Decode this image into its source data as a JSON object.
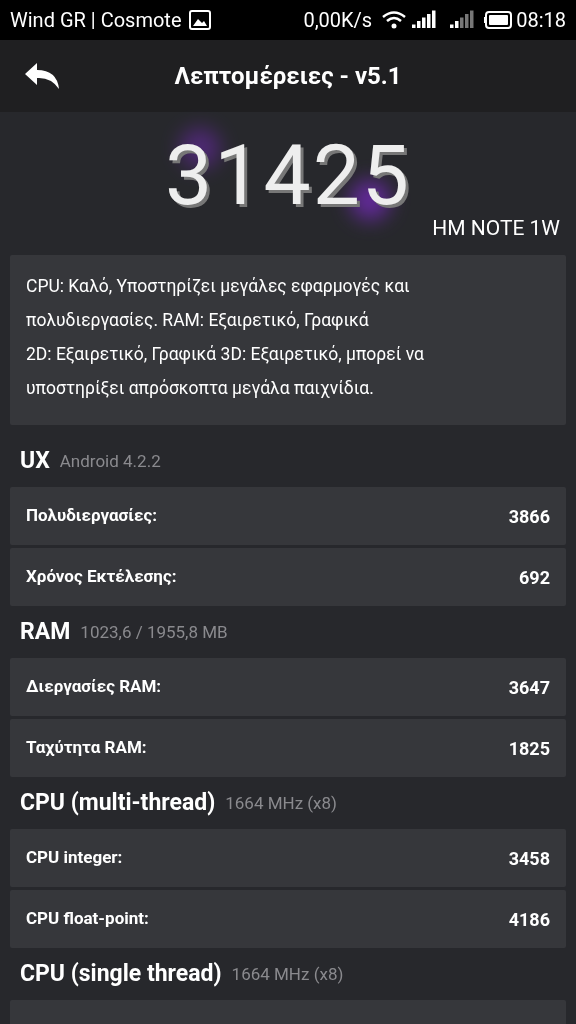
{
  "status_bar": {
    "carrier": "Wind GR | Cosmote",
    "speed": "0,00K/s",
    "time": "08:18"
  },
  "header": {
    "title": "Λεπτομέρειες - v5.1"
  },
  "score": {
    "value": "31425",
    "device": "HM NOTE 1W"
  },
  "description": [
    "CPU: Καλό, Υποστηρίζει μεγάλες εφαρμογές και",
    "πολυδιεργασίες. RAM: Εξαιρετικό, Γραφικά",
    "2D: Εξαιρετικό, Γραφικά 3D: Εξαιρετικό, μπορεί να",
    "υποστηρίξει απρόσκοπτα μεγάλα παιχνίδια."
  ],
  "sections": [
    {
      "title": "UX",
      "subtitle": "Android 4.2.2",
      "rows": [
        {
          "kind": "result",
          "label": "Πολυδιεργασίες:",
          "value": "3866"
        },
        {
          "kind": "result",
          "label": "Χρόνος Εκτέλεσης:",
          "value": "692"
        }
      ]
    },
    {
      "title": "RAM",
      "subtitle": "1023,6 / 1955,8 MB",
      "rows": [
        {
          "kind": "result",
          "label": "Διεργασίες RAM:",
          "value": "3647"
        },
        {
          "kind": "result",
          "label": "Ταχύτητα RAM:",
          "value": "1825"
        }
      ]
    },
    {
      "title": "CPU (multi-thread)",
      "subtitle": "1664 MHz (x8)",
      "rows": [
        {
          "kind": "result",
          "label": "CPU integer:",
          "value": "3458"
        },
        {
          "kind": "result",
          "label": "CPU float-point:",
          "value": "4186"
        }
      ]
    },
    {
      "title": "CPU (single thread)",
      "subtitle": "1664 MHz (x8)",
      "rows": [
        {
          "kind": "empty"
        }
      ]
    }
  ]
}
